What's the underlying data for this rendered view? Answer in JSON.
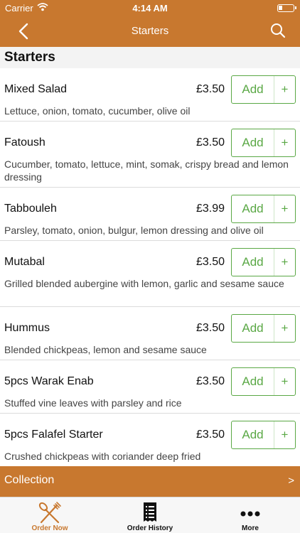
{
  "status": {
    "carrier": "Carrier",
    "time": "4:14 AM"
  },
  "nav": {
    "title": "Starters",
    "back_icon": "chevron-left-icon",
    "search_icon": "search-icon"
  },
  "section": {
    "title": "Starters"
  },
  "items": [
    {
      "name": "Mixed Salad",
      "price": "£3.50",
      "desc": "Lettuce, onion, tomato, cucumber, olive oil",
      "add": "Add",
      "plus": "+"
    },
    {
      "name": "Fatoush",
      "price": "£3.50",
      "desc": "Cucumber, tomato, lettuce, mint, somak, crispy bread and lemon dressing",
      "add": "Add",
      "plus": "+"
    },
    {
      "name": "Tabbouleh",
      "price": "£3.99",
      "desc": "Parsley, tomato, onion, bulgur, lemon dressing and olive oil",
      "add": "Add",
      "plus": "+"
    },
    {
      "name": "Mutabal",
      "price": "£3.50",
      "desc": "Grilled blended aubergine with lemon, garlic and sesame sauce",
      "add": "Add",
      "plus": "+"
    },
    {
      "name": "Hummus",
      "price": "£3.50",
      "desc": "Blended chickpeas, lemon and sesame sauce",
      "add": "Add",
      "plus": "+"
    },
    {
      "name": "5pcs Warak Enab",
      "price": "£3.50",
      "desc": "Stuffed vine leaves with parsley and rice",
      "add": "Add",
      "plus": "+"
    },
    {
      "name": "5pcs Falafel Starter",
      "price": "£3.50",
      "desc": "Crushed chickpeas with coriander deep fried",
      "add": "Add",
      "plus": "+"
    }
  ],
  "collection": {
    "label": "Collection",
    "chevron": ">"
  },
  "tabs": [
    {
      "label": "Order Now",
      "icon": "fork-knife-icon",
      "active": true
    },
    {
      "label": "Order History",
      "icon": "receipt-icon",
      "active": false
    },
    {
      "label": "More",
      "icon": "more-dots-icon",
      "active": false
    }
  ],
  "colors": {
    "brand": "#c8782f",
    "accent": "#5aa845"
  }
}
